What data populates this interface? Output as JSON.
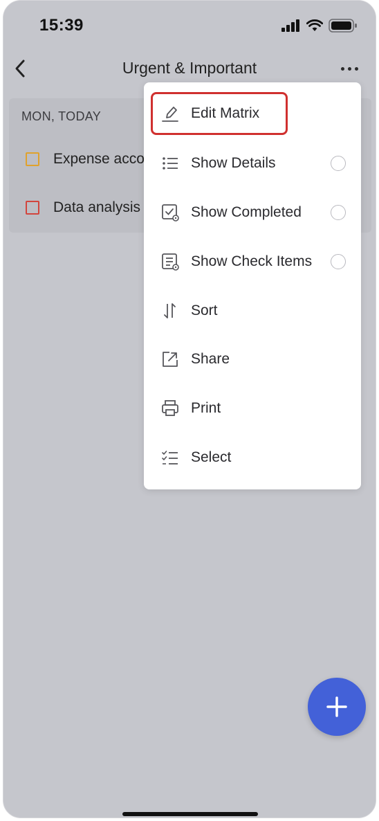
{
  "status_bar": {
    "time": "15:39"
  },
  "header": {
    "title": "Urgent & Important"
  },
  "list": {
    "section_label": "MON, TODAY",
    "tasks": [
      {
        "text": "Expense account",
        "color": "#e0a22c"
      },
      {
        "text": "Data analysis",
        "color": "#d2453d"
      }
    ]
  },
  "menu": {
    "items": [
      {
        "label": "Edit Matrix",
        "icon": "edit-icon"
      },
      {
        "label": "Show Details",
        "icon": "details-list-icon",
        "toggle": false
      },
      {
        "label": "Show Completed",
        "icon": "completed-icon",
        "toggle": false
      },
      {
        "label": "Show Check Items",
        "icon": "check-items-icon",
        "toggle": false
      },
      {
        "label": "Sort",
        "icon": "sort-icon"
      },
      {
        "label": "Share",
        "icon": "share-icon"
      },
      {
        "label": "Print",
        "icon": "print-icon"
      },
      {
        "label": "Select",
        "icon": "select-icon"
      }
    ]
  },
  "colors": {
    "accent": "#4361d8",
    "highlight": "#d0302f",
    "background": "#c5c6cc"
  }
}
